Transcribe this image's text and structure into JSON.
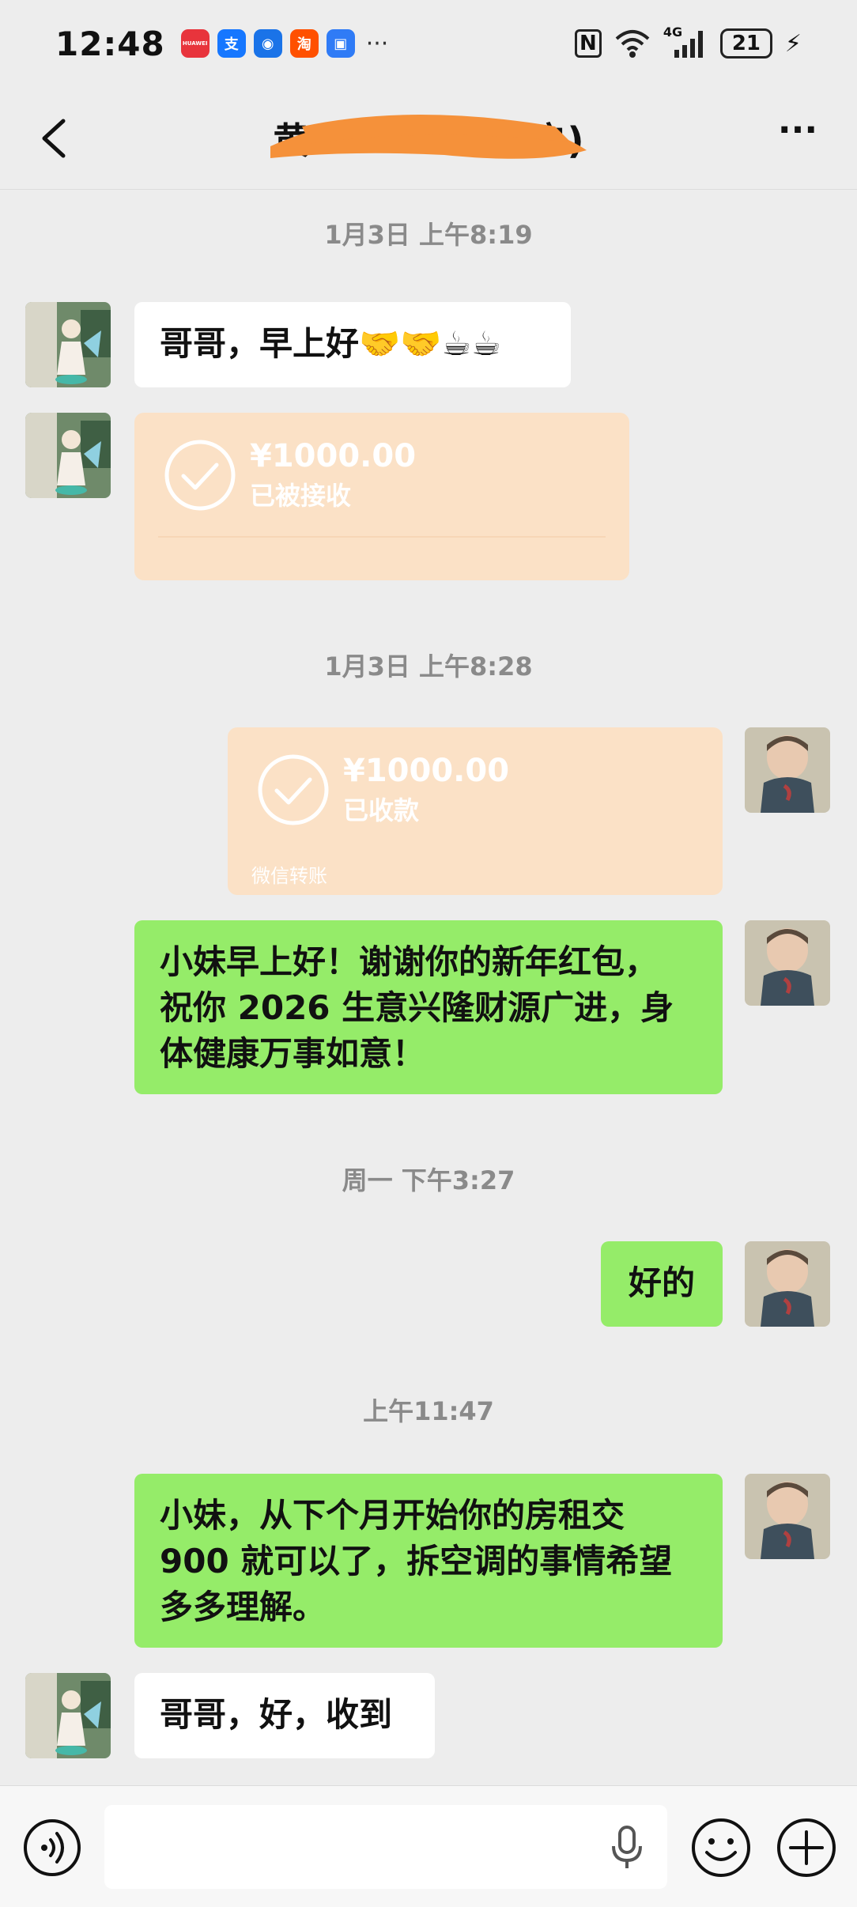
{
  "status_bar": {
    "time": "12:48",
    "app_icons": [
      {
        "name": "huawei-app-icon",
        "glyph": "HUAWEI",
        "color": "#e8343c"
      },
      {
        "name": "alipay-icon",
        "glyph": "支",
        "color": "#1677ff"
      },
      {
        "name": "app-icon",
        "glyph": "◉",
        "color": "#1a73e8"
      },
      {
        "name": "taobao-icon",
        "glyph": "淘",
        "color": "#ff5000"
      },
      {
        "name": "app-icon-2",
        "glyph": "▣",
        "color": "#2f7bf6"
      }
    ],
    "more": "···",
    "network": "4G",
    "battery": "21"
  },
  "nav": {
    "title": "黄",
    "title_suffix": "户)",
    "more": "···"
  },
  "messages": [
    {
      "kind": "timestamp",
      "text": "1月3日 上午8:19"
    },
    {
      "kind": "text",
      "side": "left",
      "text": "哥哥，早上好🤝🤝☕☕"
    },
    {
      "kind": "transfer",
      "side": "left",
      "amount": "¥1000.00",
      "status": "已被接收"
    },
    {
      "kind": "timestamp",
      "text": "1月3日 上午8:28"
    },
    {
      "kind": "transfer",
      "side": "right",
      "amount": "¥1000.00",
      "status": "已收款",
      "footer": "微信转账"
    },
    {
      "kind": "text",
      "side": "right",
      "lines": [
        "小妹早上好！谢谢你的新年红包，",
        "祝你 2026 生意兴隆财源广进，身",
        "体健康万事如意！"
      ]
    },
    {
      "kind": "timestamp",
      "text": "周一 下午3:27"
    },
    {
      "kind": "text",
      "side": "right",
      "text": "好的"
    },
    {
      "kind": "timestamp",
      "text": "上午11:47"
    },
    {
      "kind": "text",
      "side": "right",
      "lines": [
        "小妹，从下个月开始你的房租交",
        "900 就可以了，拆空调的事情希望",
        "多多理解。"
      ]
    },
    {
      "kind": "text",
      "side": "left",
      "text": "哥哥，好，收到"
    }
  ],
  "colors": {
    "background": "#ededed",
    "bubble_green": "#95ec69",
    "bubble_white": "#ffffff",
    "transfer_bg": "#fbe1c6",
    "redaction": "#f5913a"
  },
  "input_bar": {
    "placeholder": "",
    "icons": [
      "voice-icon",
      "microphone-icon",
      "emoji-icon",
      "plus-icon"
    ]
  }
}
